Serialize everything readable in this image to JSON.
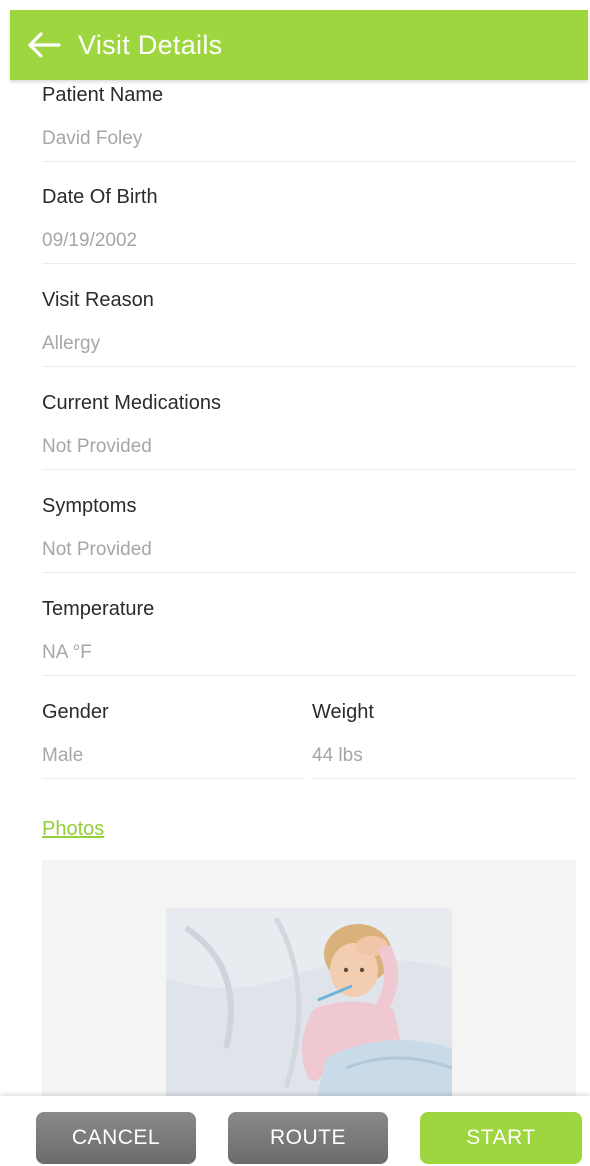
{
  "colors": {
    "accent": "#9ed63f",
    "button_gray": "#7a7a7a",
    "value_text": "#a6a6a6"
  },
  "header": {
    "back_icon": "arrow-left-icon",
    "title": "Visit Details"
  },
  "fields": {
    "patient_name": {
      "label": "Patient Name",
      "value": "David Foley"
    },
    "date_of_birth": {
      "label": "Date Of Birth",
      "value": "09/19/2002"
    },
    "visit_reason": {
      "label": "Visit Reason",
      "value": "Allergy"
    },
    "current_medications": {
      "label": "Current Medications",
      "value": "Not Provided"
    },
    "symptoms": {
      "label": "Symptoms",
      "value": "Not Provided"
    },
    "temperature": {
      "label": "Temperature",
      "value": "NA °F"
    },
    "gender": {
      "label": "Gender",
      "value": "Male"
    },
    "weight": {
      "label": "Weight",
      "value": "44 lbs"
    }
  },
  "photos": {
    "link_label": "Photos"
  },
  "actions": {
    "cancel": "CANCEL",
    "route": "ROUTE",
    "start": "START"
  }
}
